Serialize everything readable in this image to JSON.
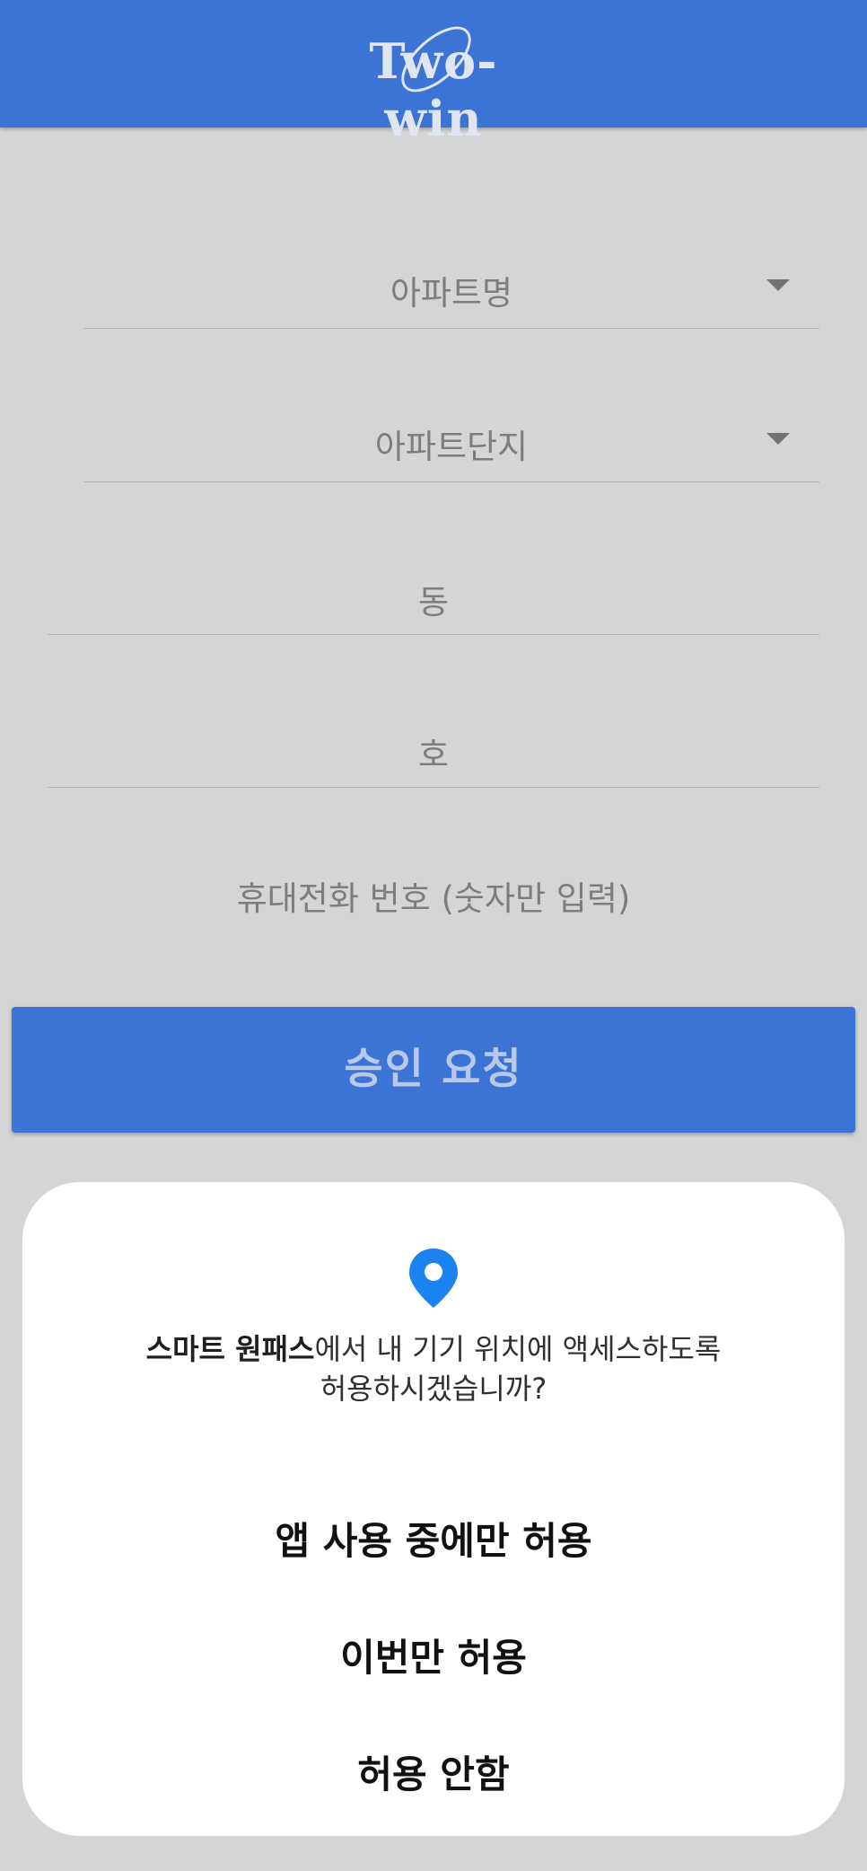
{
  "header": {
    "logo_text": "Two-win",
    "color": "#3b74d5"
  },
  "form": {
    "apartment_placeholder": "아파트명",
    "complex_placeholder": "아파트단지",
    "dong_placeholder": "동",
    "ho_placeholder": "호",
    "phone_placeholder": "휴대전화 번호 (숫자만 입력)",
    "submit_label": "승인 요청"
  },
  "dialog": {
    "icon": "location-pin-icon",
    "app_name": "스마트 원패스",
    "message_line1_rest": "에서 내 기기 위치에 액세스하도록",
    "message_line2": "허용하시겠습니까?",
    "options": [
      "앱 사용 중에만 허용",
      "이번만 허용",
      "허용 안함"
    ],
    "accent_color": "#1a83f0"
  }
}
